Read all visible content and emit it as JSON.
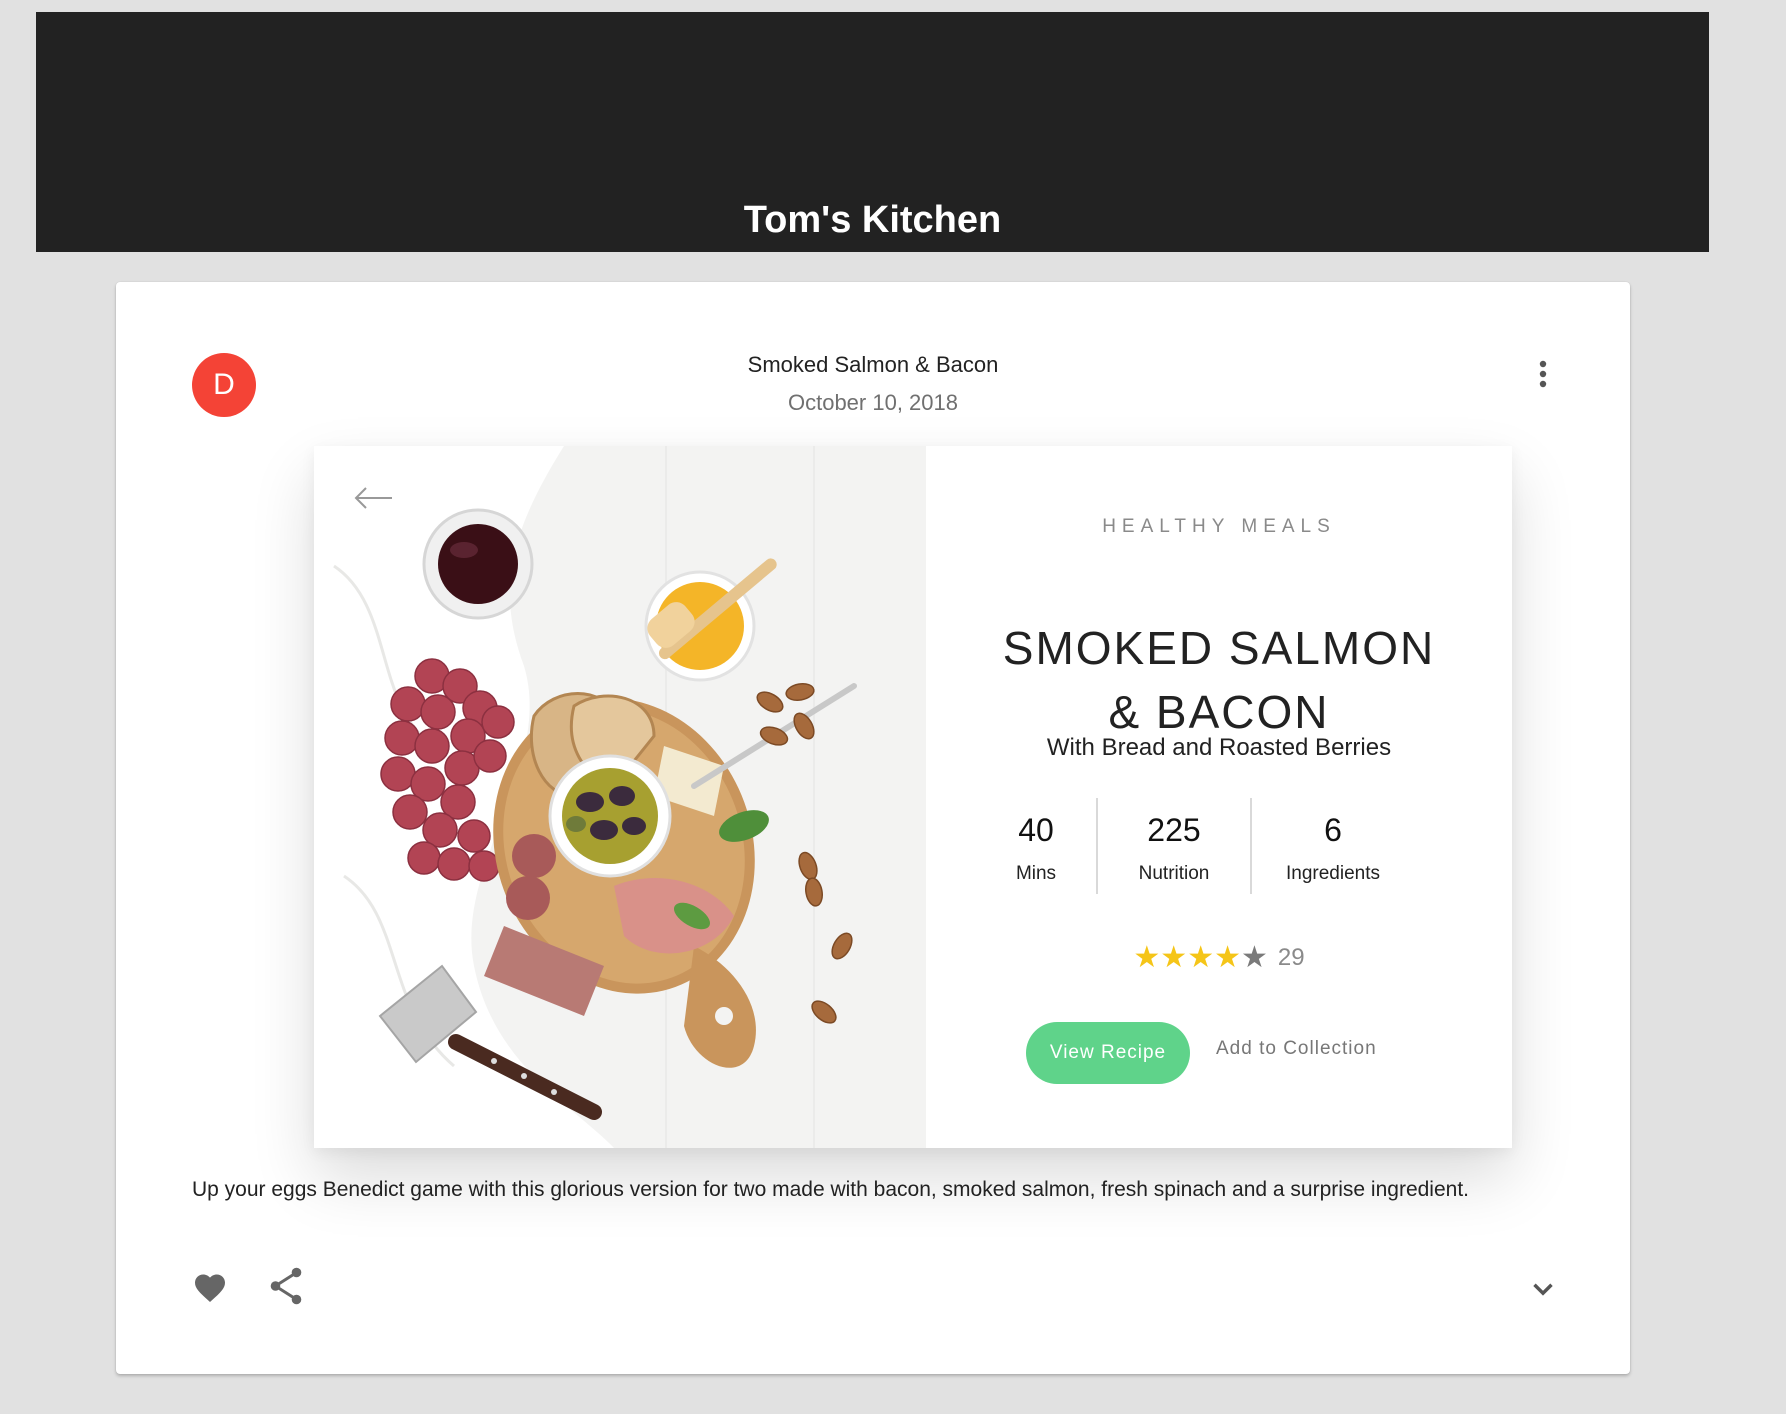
{
  "header": {
    "title": "Tom's Kitchen"
  },
  "post": {
    "avatar_letter": "D",
    "title": "Smoked Salmon & Bacon",
    "date": "October 10, 2018",
    "menu_icon": "more-vert-icon",
    "description": "Up your eggs Benedict game with this glorious version for two made with bacon, smoked salmon, fresh spinach and a surprise ingredient.",
    "actions": {
      "favorite_icon": "heart-icon",
      "share_icon": "share-icon",
      "expand_icon": "chevron-down-icon"
    }
  },
  "recipe": {
    "category": "HEALTHY MEALS",
    "title_line1": "SMOKED SALMON",
    "title_line2": "& BACON",
    "subtitle": "With Bread and Roasted Berries",
    "stats": [
      {
        "value": "40",
        "label": "Mins"
      },
      {
        "value": "225",
        "label": "Nutrition"
      },
      {
        "value": "6",
        "label": "Ingredients"
      }
    ],
    "rating": {
      "stars": 4,
      "max": 5,
      "count": "29"
    },
    "primary_button": "View Recipe",
    "secondary_button": "Add to Collection",
    "back_icon": "arrow-left-icon"
  },
  "colors": {
    "header_bg": "#222222",
    "avatar": "#f44336",
    "accent_green": "#5fd38a",
    "star": "#f5c518"
  }
}
